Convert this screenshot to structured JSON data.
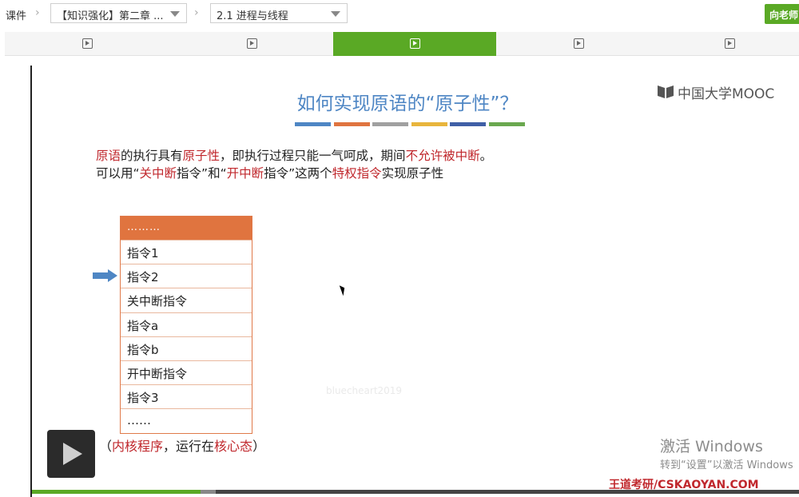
{
  "breadcrumb": {
    "root": "课件",
    "chapter_select": "【知识强化】第二章 ...",
    "lesson_select": "2.1 进程与线程",
    "teacher_button": "向老师"
  },
  "tabs": [
    {
      "active": false
    },
    {
      "active": false
    },
    {
      "active": true
    },
    {
      "active": false
    },
    {
      "active": false
    }
  ],
  "slide": {
    "title": "如何实现原语的“原子性”？",
    "logo": "中国大学MOOC",
    "color_bars": [
      "#4e86c4",
      "#e0743f",
      "#a0a0a0",
      "#e8b53c",
      "#3f5fa6",
      "#6aa84f"
    ],
    "line1": [
      {
        "text": "原语",
        "red": true
      },
      {
        "text": "的执行具有",
        "red": false
      },
      {
        "text": "原子性",
        "red": true
      },
      {
        "text": "，即执行过程只能一气呵成，期间",
        "red": false
      },
      {
        "text": "不允许被中断",
        "red": true
      },
      {
        "text": "。",
        "red": false
      }
    ],
    "line2": [
      {
        "text": "可以用“",
        "red": false
      },
      {
        "text": "关中断",
        "red": true
      },
      {
        "text": "指令”和“",
        "red": false
      },
      {
        "text": "开中断",
        "red": true
      },
      {
        "text": "指令”这两个",
        "red": false
      },
      {
        "text": "特权指令",
        "red": true
      },
      {
        "text": "实现原子性",
        "red": false
      }
    ],
    "table_header": "………",
    "table_rows": [
      "指令1",
      "指令2",
      "关中断指令",
      "指令a",
      "指令b",
      "开中断指令",
      "指令3",
      "……"
    ],
    "pointer_row": "指令2",
    "caption": [
      {
        "text": "（",
        "red": false
      },
      {
        "text": "内核程序",
        "red": true
      },
      {
        "text": "，运行在",
        "red": false
      },
      {
        "text": "核心态",
        "red": true
      },
      {
        "text": "）",
        "red": false
      }
    ],
    "watermark": "bluecheart2019",
    "brand": "王道考研/CSKAOYAN.COM"
  },
  "os_overlay": {
    "line1": "激活 Windows",
    "line2": "转到“设置”以激活 Windows"
  },
  "player": {
    "played_fraction": 0.22,
    "buffered_fraction": 0.24
  }
}
